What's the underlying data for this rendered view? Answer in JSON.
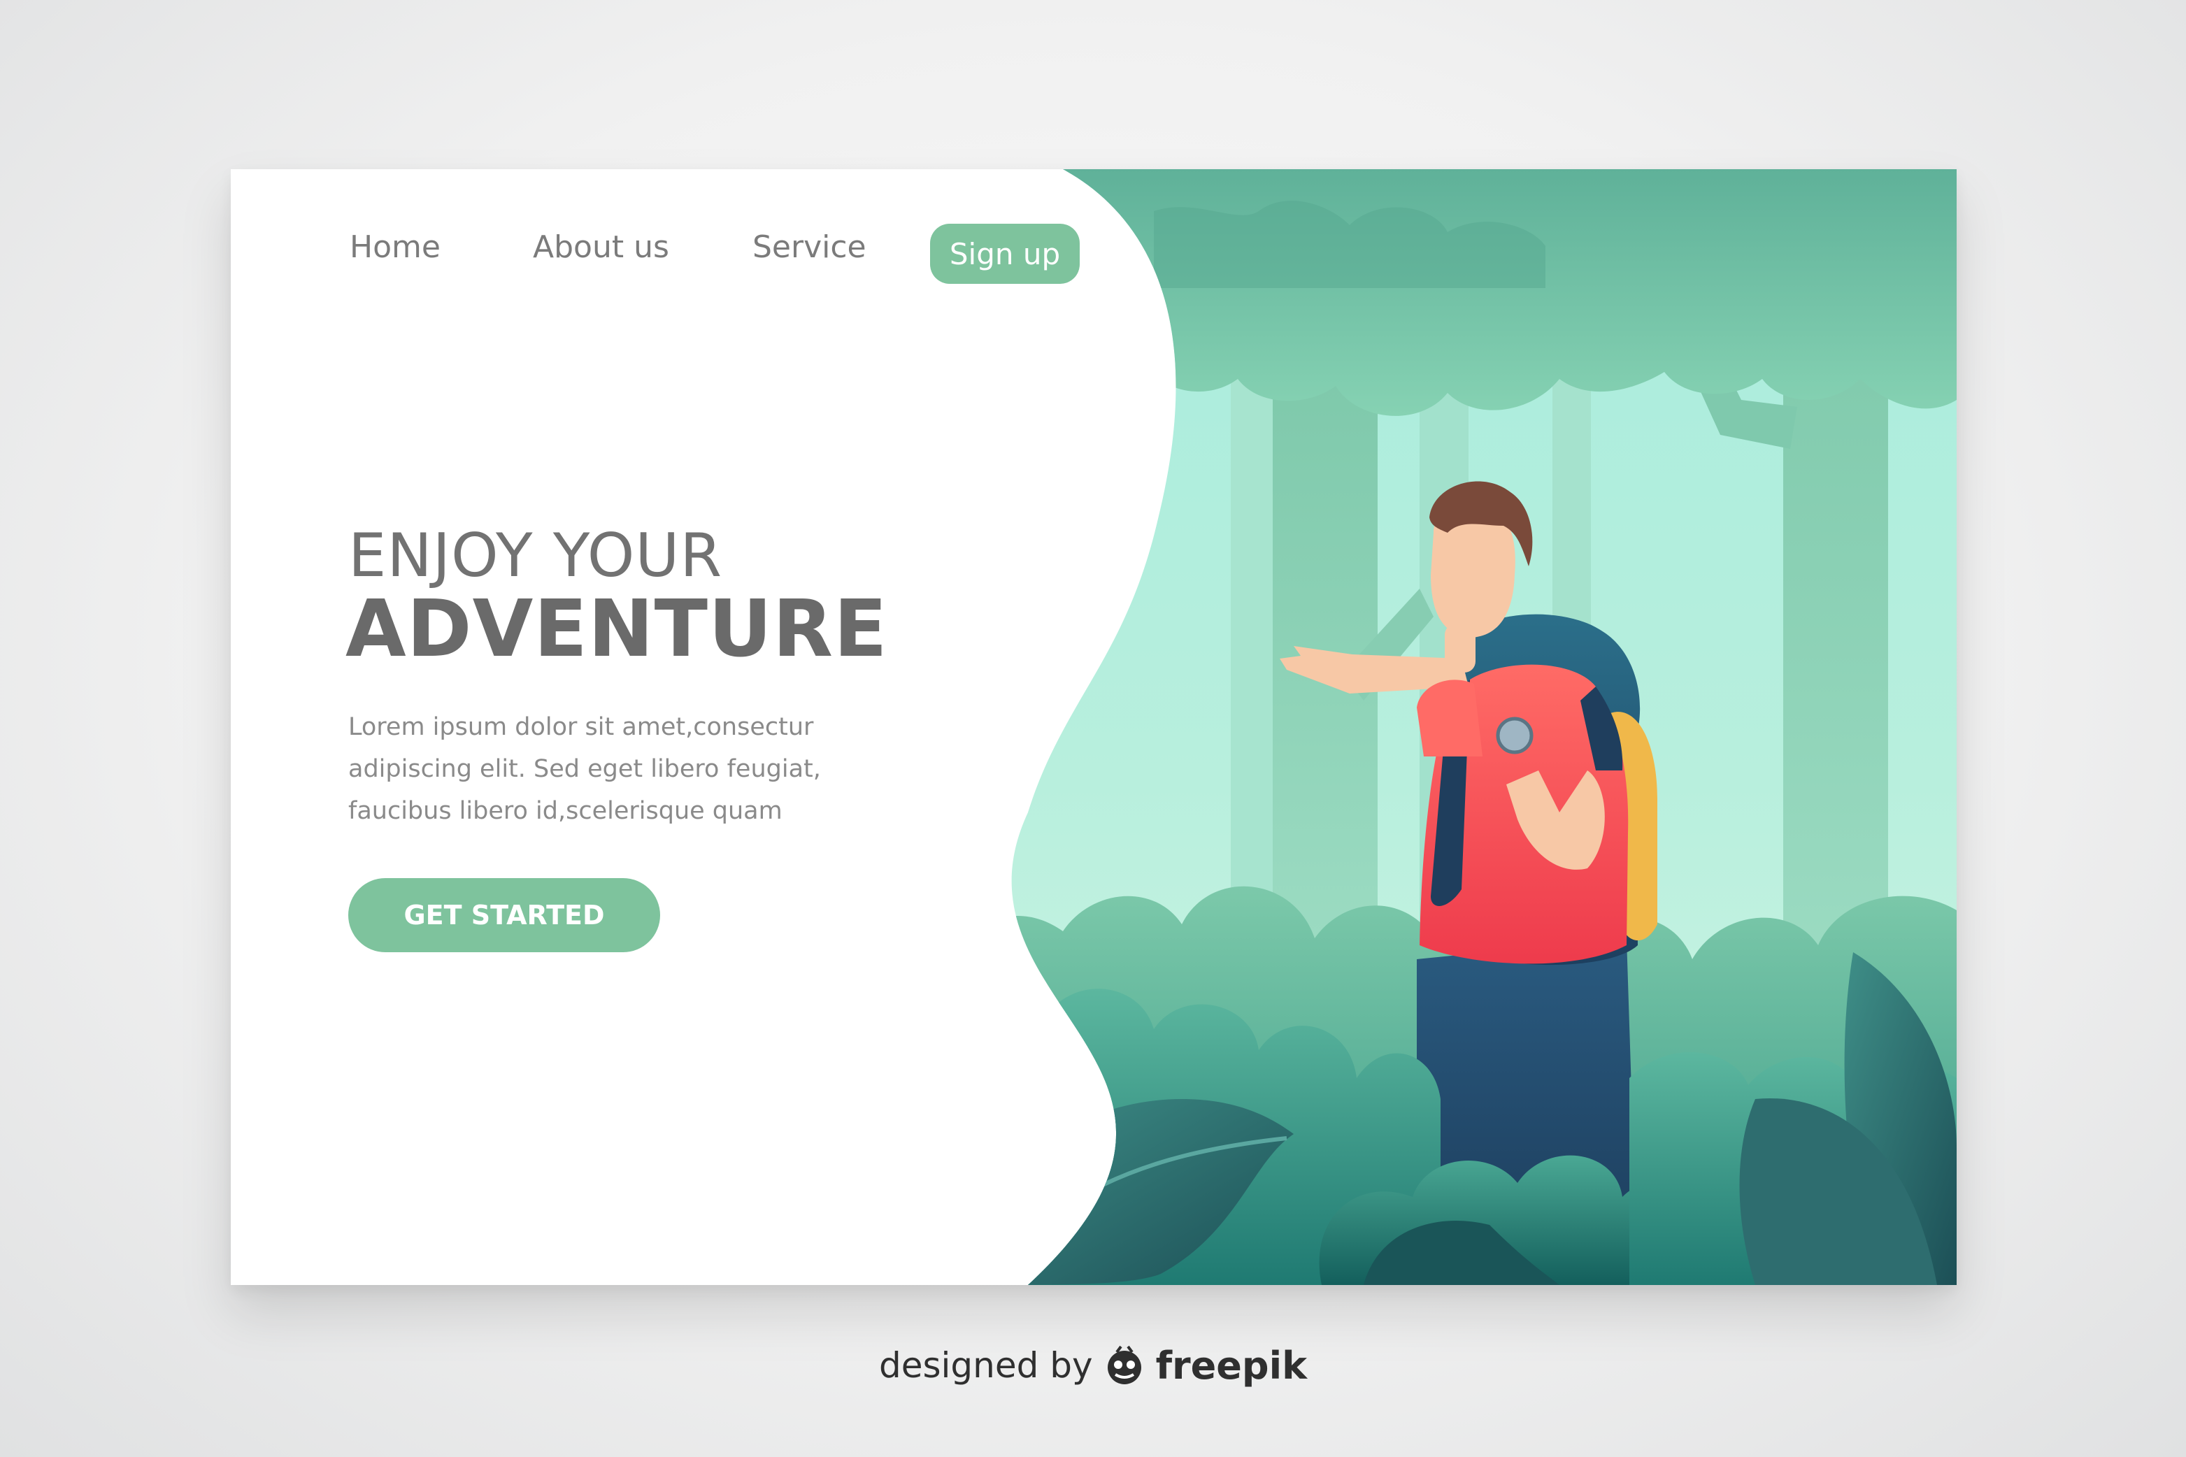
{
  "nav": {
    "home": "Home",
    "about": "About us",
    "service": "Service",
    "signup": "Sign up"
  },
  "hero": {
    "title_line1": "ENJOY YOUR",
    "title_line2": "ADVENTURE",
    "body_lines": [
      "Lorem ipsum dolor sit amet,consectur",
      "adipiscing elit. Sed eget libero feugiat,",
      "faucibus libero id,scelerisque quam"
    ],
    "cta": "GET STARTED"
  },
  "credit": {
    "prefix": "designed by",
    "brand": "freepik",
    "logo_icon": "freepik-logo-icon"
  },
  "colors": {
    "accent_green": "#7ec39d",
    "heading_gray": "#6a6a6a",
    "body_gray": "#8a8a8a",
    "shirt_red": "#f2545b",
    "pants_navy": "#23486b",
    "backpack_blue": "#27506f",
    "foliage_teal": "#2f8c80",
    "canopy_green": "#6db9a0"
  },
  "icons": [
    "compass-icon",
    "freepik-logo-icon"
  ]
}
